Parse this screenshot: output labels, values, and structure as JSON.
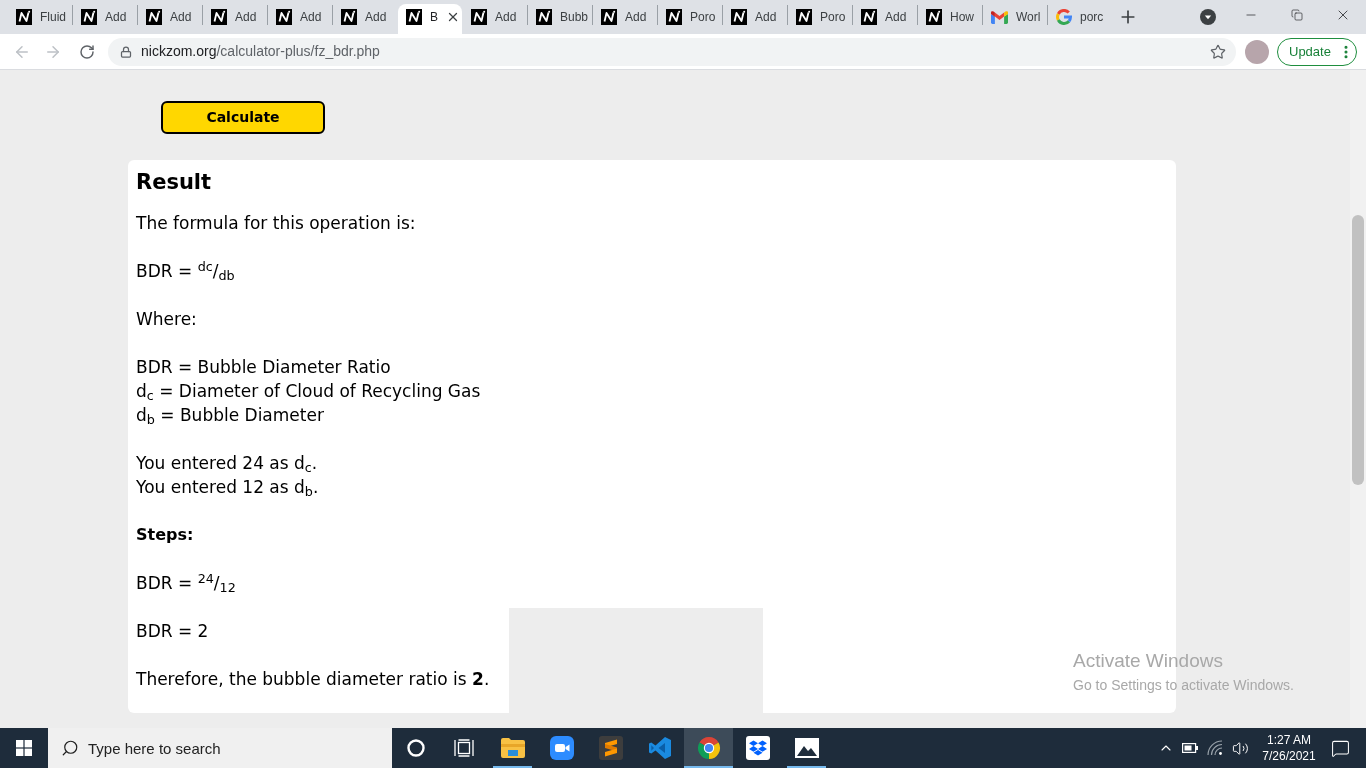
{
  "browser": {
    "tabs": [
      {
        "kind": "site",
        "label": "Fluid",
        "selected": false
      },
      {
        "kind": "site",
        "label": "Add",
        "selected": false
      },
      {
        "kind": "site",
        "label": "Add",
        "selected": false
      },
      {
        "kind": "site",
        "label": "Add",
        "selected": false
      },
      {
        "kind": "site",
        "label": "Add",
        "selected": false
      },
      {
        "kind": "site",
        "label": "Add",
        "selected": false
      },
      {
        "kind": "site",
        "label": "B",
        "selected": true
      },
      {
        "kind": "site",
        "label": "Add",
        "selected": false
      },
      {
        "kind": "site",
        "label": "Bubb",
        "selected": false
      },
      {
        "kind": "site",
        "label": "Add",
        "selected": false
      },
      {
        "kind": "site",
        "label": "Poro",
        "selected": false
      },
      {
        "kind": "site",
        "label": "Add",
        "selected": false
      },
      {
        "kind": "site",
        "label": "Poro",
        "selected": false
      },
      {
        "kind": "site",
        "label": "Add",
        "selected": false
      },
      {
        "kind": "site",
        "label": "How",
        "selected": false
      },
      {
        "kind": "mail",
        "label": "Worl",
        "selected": false
      },
      {
        "kind": "search",
        "label": "porc",
        "selected": false
      }
    ],
    "back": {
      "disabled": true
    },
    "forward": {
      "disabled": true
    },
    "address": {
      "host": "nickzom.org",
      "path": "/calculator-plus/fz_bdr.php"
    },
    "update_button": "Update"
  },
  "page": {
    "calculate_button": "Calculate",
    "result": {
      "title": "Result",
      "blocks": [
        {
          "kind": "text",
          "lines": [
            "The formula for this operation is:"
          ]
        },
        {
          "kind": "text",
          "lines": [
            "BDR = $^{dc}$/$_{db}$"
          ]
        },
        {
          "kind": "text",
          "lines": [
            "Where:"
          ]
        },
        {
          "kind": "text",
          "lines": [
            "BDR = Bubble Diameter Ratio",
            "d$_{c}$ = Diameter of Cloud of Recycling Gas",
            "d$_{b}$ = Bubble Diameter"
          ]
        },
        {
          "kind": "text",
          "lines": [
            "You entered 24 as d$_{c}$.",
            "You entered 12 as d$_{b}$."
          ]
        },
        {
          "kind": "heading",
          "lines": [
            "Steps:"
          ]
        },
        {
          "kind": "text",
          "lines": [
            "BDR = $^{24}$/$_{12}$"
          ]
        },
        {
          "kind": "text",
          "lines": [
            "BDR = 2"
          ]
        },
        {
          "kind": "text",
          "lines": [
            "Therefore, the bubble diameter ratio is **2**."
          ]
        }
      ]
    }
  },
  "activation_notice": {
    "title": "Activate Windows",
    "message": "Go to Settings to activate Windows."
  },
  "taskbar": {
    "search_placeholder": "Type here to search",
    "apps": [
      {
        "kind": "folder",
        "running": true,
        "selected": false
      },
      {
        "kind": "video",
        "running": false,
        "selected": false
      },
      {
        "kind": "editor",
        "running": false,
        "selected": false
      },
      {
        "kind": "code",
        "running": false,
        "selected": false
      },
      {
        "kind": "browser",
        "running": true,
        "selected": true
      },
      {
        "kind": "cloud",
        "running": false,
        "selected": false
      },
      {
        "kind": "photos",
        "running": true,
        "selected": false
      }
    ],
    "time": "1:27 AM",
    "date": "7/26/2021"
  }
}
